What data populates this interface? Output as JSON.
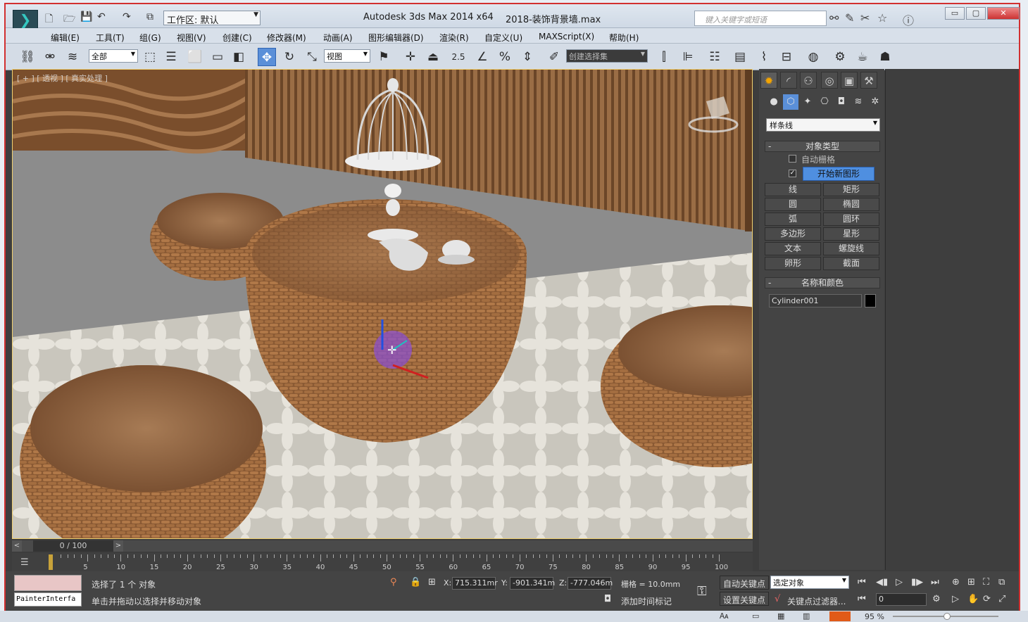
{
  "titlebar": {
    "workspace_label": "工作区: 默认",
    "app_title": "Autodesk 3ds Max  2014 x64",
    "file_title": "2018-装饰背景墙.max",
    "search_placeholder": "键入关键字或短语",
    "min_label": "▭",
    "max_label": "▢",
    "close_label": "✕"
  },
  "menubar": {
    "items": [
      "编辑(E)",
      "工具(T)",
      "组(G)",
      "视图(V)",
      "创建(C)",
      "修改器(M)",
      "动画(A)",
      "图形编辑器(D)",
      "渲染(R)",
      "自定义(U)",
      "MAXScript(X)",
      "帮助(H)"
    ]
  },
  "toolbar": {
    "filter_value": "全部",
    "refcoord_value": "视图",
    "snap_value": "2.5",
    "selset_value": "创建选择集"
  },
  "viewport": {
    "label": "[ + ] [ 透视 ] [ 真实处理 ]"
  },
  "command_panel": {
    "category_value": "样条线",
    "object_type_header": "对象类型",
    "auto_grid_label": "自动栅格",
    "start_new_shape_label": "开始新图形",
    "start_new_shape_checked": "✓",
    "buttons": [
      "线",
      "矩形",
      "圆",
      "椭圆",
      "弧",
      "圆环",
      "多边形",
      "星形",
      "文本",
      "螺旋线",
      "卵形",
      "截面"
    ],
    "name_color_header": "名称和颜色",
    "object_name": "Cylinder001",
    "object_color": "#000000",
    "collapse_sign": "-"
  },
  "timeline": {
    "frame_display": "0 / 100",
    "prev_label": "<",
    "next_label": ">",
    "ticks": [
      "5",
      "10",
      "15",
      "20",
      "25",
      "30",
      "35",
      "40",
      "45",
      "50",
      "55",
      "60",
      "65",
      "70",
      "75",
      "80",
      "85",
      "90",
      "95",
      "100"
    ]
  },
  "status": {
    "script_name": "PainterInterfa",
    "selected_text": "选择了 1 个 对象",
    "prompt_text": "单击并拖动以选择并移动对象",
    "x_label": "X:",
    "x_value": "715.311mr",
    "y_label": "Y:",
    "y_value": "-901.341m",
    "z_label": "Z:",
    "z_value": "-777.046m",
    "grid_text": "栅格 = 10.0mm",
    "add_time_tag": "添加时间标记",
    "auto_key": "自动关键点",
    "set_key": "设置关键点",
    "key_mode_value": "选定对象",
    "key_filters": "关键点过滤器...",
    "frame_value": "0"
  },
  "bottom": {
    "zoom_value": "95 %"
  }
}
